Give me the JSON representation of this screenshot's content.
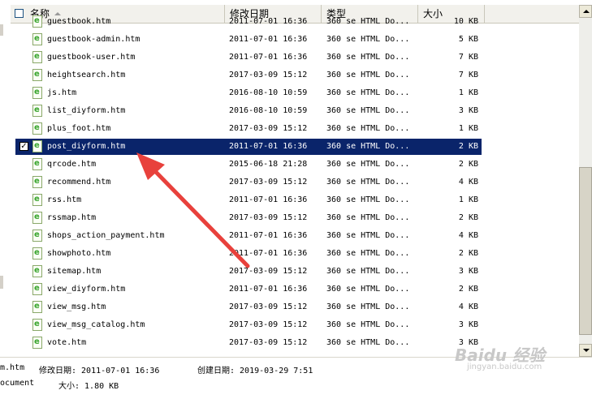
{
  "columns": {
    "name": "名称",
    "date": "修改日期",
    "type": "类型",
    "size": "大小"
  },
  "files": [
    {
      "name": "guestbook.htm",
      "date": "2011-07-01 16:36",
      "type": "360 se HTML Do...",
      "size": "10 KB",
      "selected": false
    },
    {
      "name": "guestbook-admin.htm",
      "date": "2011-07-01 16:36",
      "type": "360 se HTML Do...",
      "size": "5 KB",
      "selected": false
    },
    {
      "name": "guestbook-user.htm",
      "date": "2011-07-01 16:36",
      "type": "360 se HTML Do...",
      "size": "7 KB",
      "selected": false
    },
    {
      "name": "heightsearch.htm",
      "date": "2017-03-09 15:12",
      "type": "360 se HTML Do...",
      "size": "7 KB",
      "selected": false
    },
    {
      "name": "js.htm",
      "date": "2016-08-10 10:59",
      "type": "360 se HTML Do...",
      "size": "1 KB",
      "selected": false
    },
    {
      "name": "list_diyform.htm",
      "date": "2016-08-10 10:59",
      "type": "360 se HTML Do...",
      "size": "3 KB",
      "selected": false
    },
    {
      "name": "plus_foot.htm",
      "date": "2017-03-09 15:12",
      "type": "360 se HTML Do...",
      "size": "1 KB",
      "selected": false
    },
    {
      "name": "post_diyform.htm",
      "date": "2011-07-01 16:36",
      "type": "360 se HTML Do...",
      "size": "2 KB",
      "selected": true
    },
    {
      "name": "qrcode.htm",
      "date": "2015-06-18 21:28",
      "type": "360 se HTML Do...",
      "size": "2 KB",
      "selected": false
    },
    {
      "name": "recommend.htm",
      "date": "2017-03-09 15:12",
      "type": "360 se HTML Do...",
      "size": "4 KB",
      "selected": false
    },
    {
      "name": "rss.htm",
      "date": "2011-07-01 16:36",
      "type": "360 se HTML Do...",
      "size": "1 KB",
      "selected": false
    },
    {
      "name": "rssmap.htm",
      "date": "2017-03-09 15:12",
      "type": "360 se HTML Do...",
      "size": "2 KB",
      "selected": false
    },
    {
      "name": "shops_action_payment.htm",
      "date": "2011-07-01 16:36",
      "type": "360 se HTML Do...",
      "size": "4 KB",
      "selected": false
    },
    {
      "name": "showphoto.htm",
      "date": "2011-07-01 16:36",
      "type": "360 se HTML Do...",
      "size": "2 KB",
      "selected": false
    },
    {
      "name": "sitemap.htm",
      "date": "2017-03-09 15:12",
      "type": "360 se HTML Do...",
      "size": "3 KB",
      "selected": false
    },
    {
      "name": "view_diyform.htm",
      "date": "2011-07-01 16:36",
      "type": "360 se HTML Do...",
      "size": "2 KB",
      "selected": false
    },
    {
      "name": "view_msg.htm",
      "date": "2017-03-09 15:12",
      "type": "360 se HTML Do...",
      "size": "4 KB",
      "selected": false
    },
    {
      "name": "view_msg_catalog.htm",
      "date": "2017-03-09 15:12",
      "type": "360 se HTML Do...",
      "size": "3 KB",
      "selected": false
    },
    {
      "name": "vote.htm",
      "date": "2017-03-09 15:12",
      "type": "360 se HTML Do...",
      "size": "3 KB",
      "selected": false
    }
  ],
  "details": {
    "name_fragment": "m.htm",
    "modified": "修改日期: 2011-07-01 16:36",
    "created": "创建日期: 2019-03-29 7:51",
    "type_fragment": "ocument",
    "size": "大小: 1.80 KB"
  },
  "watermark": {
    "logo": "Baidu 经验",
    "url": "jingyan.baidu.com"
  },
  "colors": {
    "selection": "#0a246a",
    "annotation_arrow": "#e8413c"
  },
  "icons": {
    "file": "ie-html-file-icon",
    "check": "checkbox-icon"
  }
}
